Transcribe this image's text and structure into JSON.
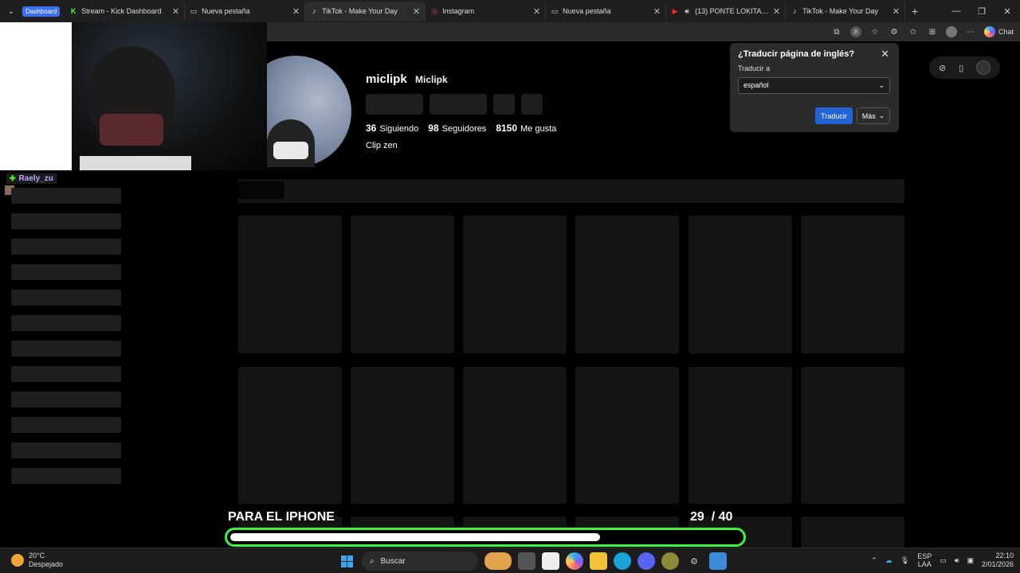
{
  "tabbar": {
    "profile": "Dashboard",
    "tabs": [
      {
        "title": "Stream - Kick Dashboard",
        "icon": "K"
      },
      {
        "title": "Nueva pestaña",
        "icon": "▭"
      },
      {
        "title": "TikTok - Make Your Day",
        "icon": "♪"
      },
      {
        "title": "Instagram",
        "icon": "◎"
      },
      {
        "title": "Nueva pestaña",
        "icon": "▭"
      },
      {
        "title": "(13) PONTE LOKITA - Katteyes",
        "icon": "▶"
      },
      {
        "title": "TikTok - Make Your Day",
        "icon": "♪"
      }
    ],
    "new_tab": "+"
  },
  "addressbar": {
    "chat_label": "Chat"
  },
  "chat": {
    "username": "Raely_zu"
  },
  "profile": {
    "username": "miclipk",
    "nickname": "Miclipk",
    "following": "36",
    "following_label": "Siguiendo",
    "followers": "98",
    "followers_label": "Seguidores",
    "likes": "8150",
    "likes_label": "Me gusta",
    "bio": "Clip zen"
  },
  "translate_popup": {
    "title": "¿Traducir página de inglés?",
    "label": "Traducir a",
    "selected_language": "español",
    "translate_button": "Traducir",
    "more_button": "Más"
  },
  "goal": {
    "label": "PARA EL IPHONE",
    "current": "29",
    "separator": "/",
    "target": "40",
    "progress_fraction": 0.725,
    "color": "#3ef23e"
  },
  "taskbar": {
    "weather_temp": "20°C",
    "weather_desc": "Despejado",
    "search_placeholder": "Buscar",
    "lang_1": "ESP",
    "lang_2": "LAA",
    "time": "22:10",
    "date": "2/01/2026"
  }
}
